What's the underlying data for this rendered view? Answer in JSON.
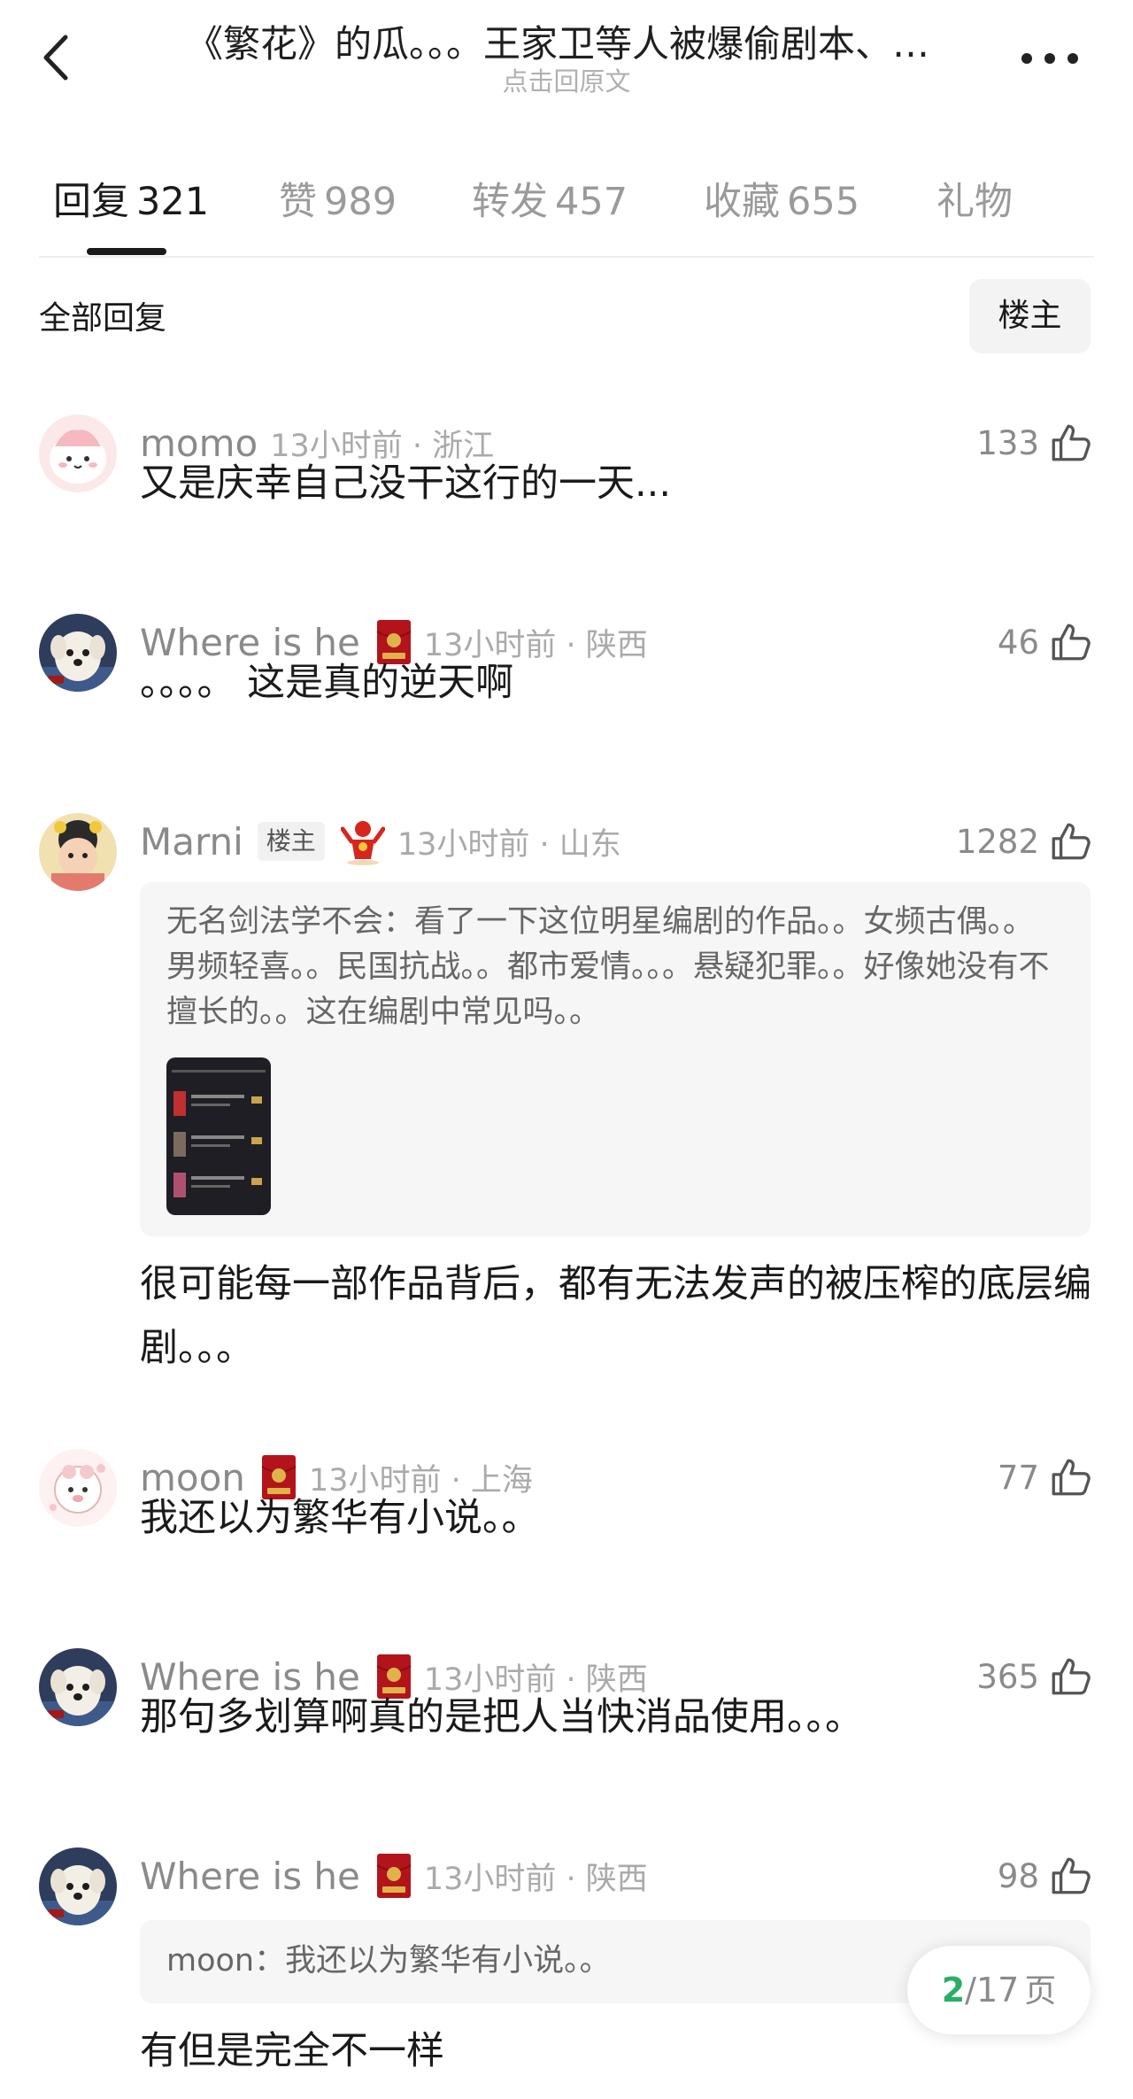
{
  "header": {
    "title": "《繁花》的瓜。。。王家卫等人被爆偷剧本、…",
    "subtitle": "点击回原文",
    "back_icon": "chevron-left-icon",
    "more_icon": "more-dots-icon"
  },
  "tabs": [
    {
      "label": "回复",
      "count": "321",
      "active": true
    },
    {
      "label": "赞",
      "count": "989",
      "active": false
    },
    {
      "label": "转发",
      "count": "457",
      "active": false
    },
    {
      "label": "收藏",
      "count": "655",
      "active": false
    },
    {
      "label": "礼物",
      "count": "",
      "active": false
    }
  ],
  "filter": {
    "label": "全部回复",
    "owner_button": "楼主"
  },
  "comments": [
    {
      "username": "momo",
      "time": "13小时前 · 浙江",
      "likes": "133",
      "content": "又是庆幸自己没干这行的一天..."
    },
    {
      "username": "Where is he",
      "time": "13小时前 · 陕西",
      "likes": "46",
      "content": "。。。。 这是真的逆天啊"
    },
    {
      "username": "Marni",
      "owner_tag": "楼主",
      "time": "13小时前 · 山东",
      "likes": "1282",
      "quote": {
        "author": "无名剑法学不会：",
        "text": "看了一下这位明星编剧的作品。。女频古偶。。男频轻喜。。民国抗战。。都市爱情。。。悬疑犯罪。。好像她没有不擅长的。。这在编剧中常见吗。。"
      },
      "content": "很可能每一部作品背后，都有无法发声的被压榨的底层编剧。。。"
    },
    {
      "username": "moon",
      "time": "13小时前 · 上海",
      "likes": "77",
      "content": "我还以为繁华有小说。。"
    },
    {
      "username": "Where is he",
      "time": "13小时前 · 陕西",
      "likes": "365",
      "content": "那句多划算啊真的是把人当快消品使用。。。"
    },
    {
      "username": "Where is he",
      "time": "13小时前 · 陕西",
      "likes": "98",
      "quote": {
        "author": "moon：",
        "text": "我还以为繁华有小说。。"
      },
      "content": "有但是完全不一样"
    }
  ],
  "pager": {
    "current": "2",
    "total": "/17",
    "unit": "页"
  },
  "colors": {
    "accent_green": "#2aae67",
    "badge_red": "#b3141c",
    "gold": "#e0b24a"
  }
}
